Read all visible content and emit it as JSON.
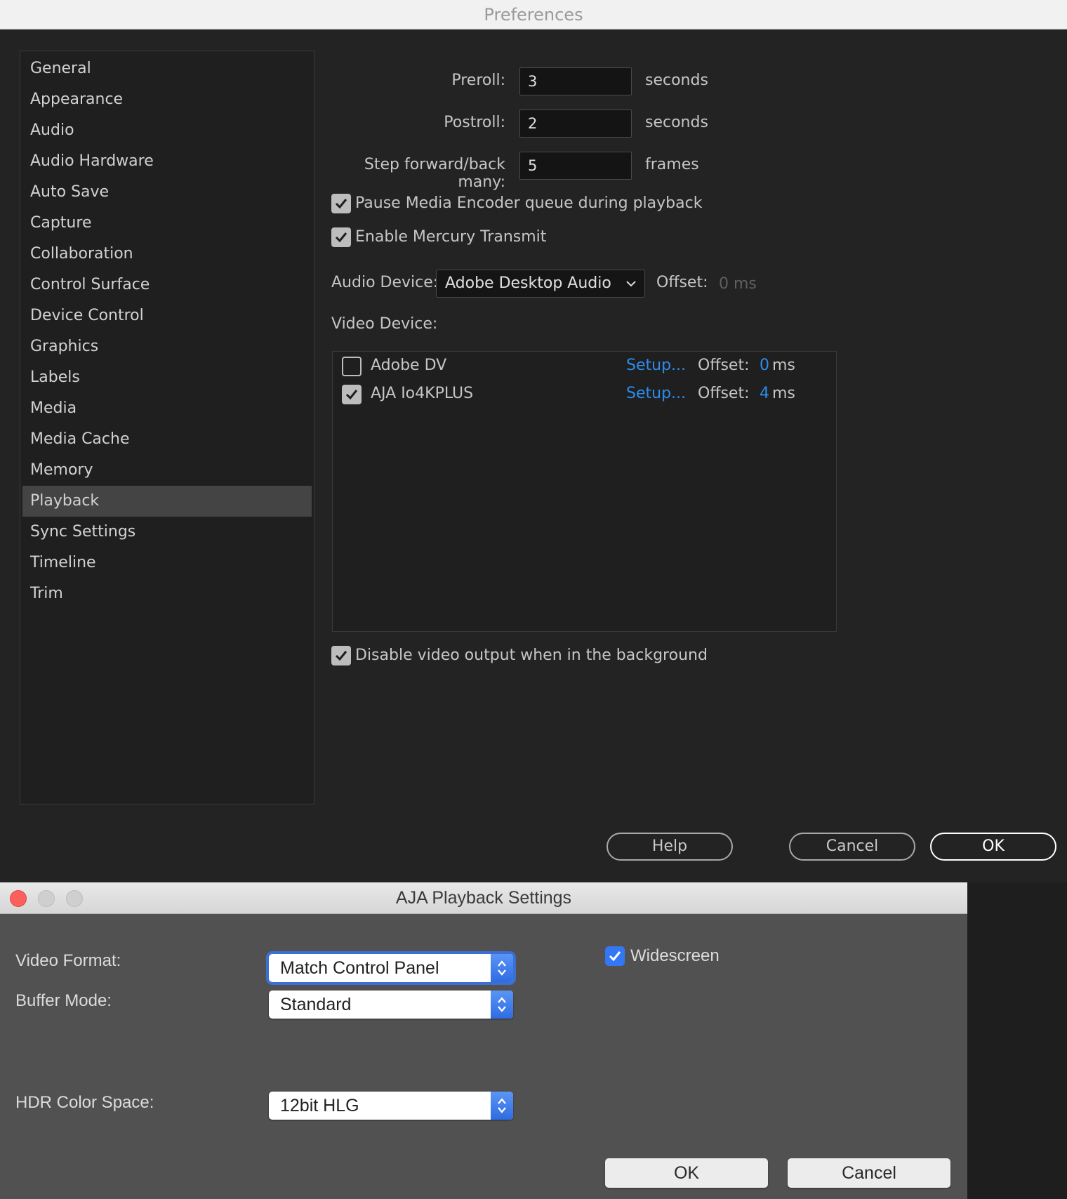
{
  "preferences": {
    "window_title": "Preferences",
    "sidebar": {
      "items": [
        {
          "label": "General"
        },
        {
          "label": "Appearance"
        },
        {
          "label": "Audio"
        },
        {
          "label": "Audio Hardware"
        },
        {
          "label": "Auto Save"
        },
        {
          "label": "Capture"
        },
        {
          "label": "Collaboration"
        },
        {
          "label": "Control Surface"
        },
        {
          "label": "Device Control"
        },
        {
          "label": "Graphics"
        },
        {
          "label": "Labels"
        },
        {
          "label": "Media"
        },
        {
          "label": "Media Cache"
        },
        {
          "label": "Memory"
        },
        {
          "label": "Playback"
        },
        {
          "label": "Sync Settings"
        },
        {
          "label": "Timeline"
        },
        {
          "label": "Trim"
        }
      ],
      "selected": "Playback"
    },
    "playback": {
      "preroll": {
        "label": "Preroll:",
        "value": "3",
        "unit": "seconds"
      },
      "postroll": {
        "label": "Postroll:",
        "value": "2",
        "unit": "seconds"
      },
      "step": {
        "label": "Step forward/back many:",
        "value": "5",
        "unit": "frames"
      },
      "pause_encoder": {
        "label": "Pause Media Encoder queue during playback",
        "checked": true
      },
      "mercury_transmit": {
        "label": "Enable Mercury Transmit",
        "checked": true
      },
      "audio_device": {
        "label": "Audio Device:",
        "value": "Adobe Desktop Audio",
        "offset_label": "Offset:",
        "offset_value": "0 ms"
      },
      "video_device_label": "Video Device:",
      "video_devices": [
        {
          "name": "Adobe DV",
          "checked": false,
          "setup": "Setup...",
          "offset_label": "Offset:",
          "offset_value": "0",
          "offset_unit": "ms"
        },
        {
          "name": "AJA Io4KPLUS",
          "checked": true,
          "setup": "Setup...",
          "offset_label": "Offset:",
          "offset_value": "4",
          "offset_unit": "ms"
        }
      ],
      "disable_background": {
        "label": "Disable video output when in the background",
        "checked": true
      }
    },
    "buttons": {
      "help": "Help",
      "cancel": "Cancel",
      "ok": "OK"
    }
  },
  "aja_dialog": {
    "title": "AJA Playback Settings",
    "video_format": {
      "label": "Video Format:",
      "value": "Match Control Panel"
    },
    "widescreen": {
      "label": "Widescreen",
      "checked": true
    },
    "buffer_mode": {
      "label": "Buffer Mode:",
      "value": "Standard"
    },
    "hdr_color_space": {
      "label": "HDR Color Space:",
      "value": "12bit HLG"
    },
    "buttons": {
      "ok": "OK",
      "cancel": "Cancel"
    }
  },
  "colors": {
    "accent_link": "#2d8ceb",
    "selection_bg": "#444444",
    "mac_blue": "#3477f5",
    "close_red": "#fc605c"
  }
}
